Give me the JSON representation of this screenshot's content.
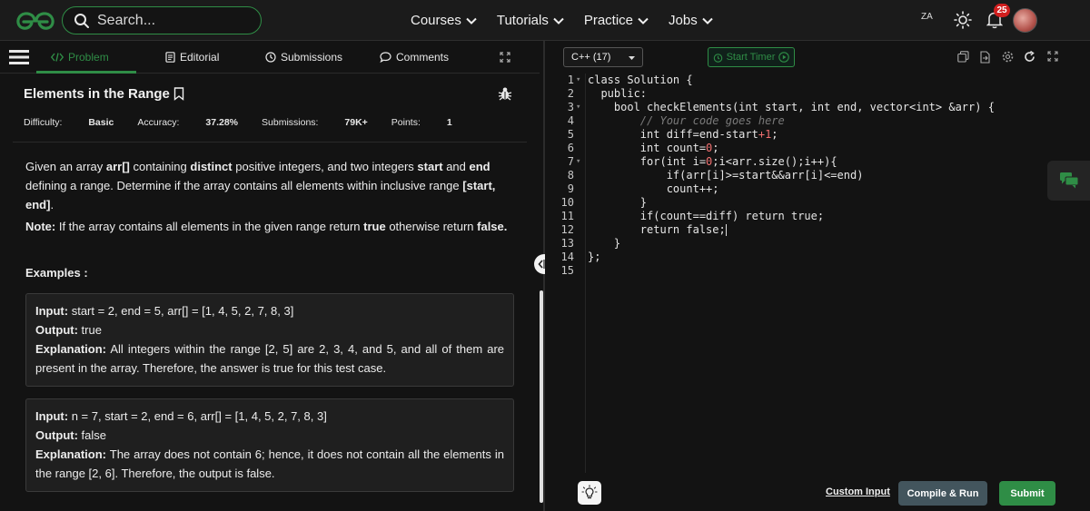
{
  "nav": {
    "search_placeholder": "Search...",
    "menu": [
      {
        "label": "Courses"
      },
      {
        "label": "Tutorials"
      },
      {
        "label": "Practice"
      },
      {
        "label": "Jobs"
      }
    ],
    "notification_count": "25",
    "translate_glyph": "ZA",
    "brand_color": "#2f8d46"
  },
  "tabs": {
    "problem": "Problem",
    "editorial": "Editorial",
    "submissions": "Submissions",
    "comments": "Comments"
  },
  "problem": {
    "title": "Elements in the Range",
    "difficulty_label": "Difficulty:",
    "difficulty": "Basic",
    "accuracy_label": "Accuracy:",
    "accuracy": "37.28%",
    "submissions_label": "Submissions:",
    "submissions": "79K+",
    "points_label": "Points:",
    "points": "1",
    "desc_1": "Given an array ",
    "desc_arr": "arr[]",
    "desc_2": " containing ",
    "desc_distinct": "distinct",
    "desc_3": " positive integers, and two integers ",
    "desc_start": "start",
    "desc_4": " and ",
    "desc_end": "end",
    "desc_5": " defining a range. Determine if the array contains all elements within inclusive range ",
    "desc_range": "[start, end]",
    "desc_6": ".",
    "note_label": "Note:",
    "note_1": " If the array contains all elements in the given range return ",
    "note_true": "true",
    "note_2": " otherwise return ",
    "note_false": "false.",
    "examples_label": "Examples :",
    "examples": [
      {
        "input_label": "Input:",
        "input": " start  =  2, end  =  5, arr[]  =   [1, 4, 5, 2, 7, 8, 3]",
        "output_label": "Output:",
        "output": " true",
        "explanation_label": "Explanation:",
        "explanation": " All integers within the range [2, 5] are 2, 3, 4, and 5, and all of them are present in the array. Therefore, the answer is true for this test case."
      },
      {
        "input_label": "Input:",
        "input": " n  =  7, start  =  2, end  =  6, arr[]  =  [1, 4, 5, 2, 7, 8, 3]",
        "output_label": "Output:",
        "output": " false",
        "explanation_label": "Explanation:",
        "explanation": " The array does not contain 6; hence, it does not contain all the elements in the range [2, 6]. Therefore, the output is false."
      }
    ]
  },
  "editor": {
    "language": "C++ (17)",
    "timer_label": "Start Timer",
    "line_numbers": [
      "1",
      "2",
      "3",
      "4",
      "5",
      "6",
      "7",
      "8",
      "9",
      "10",
      "11",
      "12",
      "13",
      "14",
      "15"
    ],
    "code": {
      "l1": "class Solution {",
      "l2": "  public:",
      "l3": "    bool checkElements(int start, int end, vector<int> &arr) {",
      "l4": "        // Your code goes here",
      "l5a": "        int diff=end-start",
      "l5b": "+1",
      "l5c": ";",
      "l6a": "        int count=",
      "l6b": "0",
      "l6c": ";",
      "l7a": "        for(int i=",
      "l7b": "0",
      "l7c": ";i<arr.size();i++){",
      "l8": "            if(arr[i]>=start&&arr[i]<=end)",
      "l9": "            count++;",
      "l10": "        }",
      "l11": "        if(count==diff) return true;",
      "l12": "        return false;",
      "l13": "    }",
      "l14": "};",
      "l15": ""
    },
    "custom_input": "Custom Input",
    "compile_run": "Compile & Run",
    "submit": "Submit"
  }
}
